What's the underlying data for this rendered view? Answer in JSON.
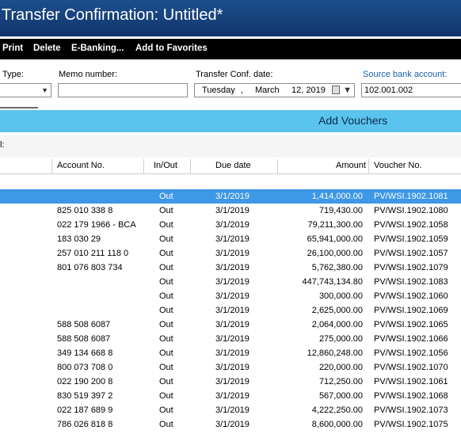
{
  "window": {
    "title": "Transfer Confirmation: Untitled*"
  },
  "toolbar": {
    "print": "Print",
    "delete": "Delete",
    "ebanking": "E-Banking...",
    "favorites": "Add to Favorites"
  },
  "form": {
    "type_label": "Type:",
    "type_value": "",
    "memo_label": "Memo number:",
    "memo_value": "",
    "date_label": "Transfer Conf. date:",
    "date_weekday": "Tuesday",
    "date_sep": ",",
    "date_month": "March",
    "date_daymonth": "12, 2019",
    "source_label": "Source bank account:",
    "source_value": "102.001.002"
  },
  "add_vouchers": "Add Vouchers",
  "subbar_text": "l:",
  "table": {
    "headers": {
      "account": "Account No.",
      "inout": "In/Out",
      "due": "Due date",
      "amount": "Amount",
      "voucher": "Voucher No."
    },
    "rows": [
      {
        "account": "",
        "inout": "Out",
        "due": "3/1/2019",
        "amount": "1,414,000.00",
        "voucher": "PV/WSI.1902.1081"
      },
      {
        "account": "825 010 338 8",
        "inout": "Out",
        "due": "3/1/2019",
        "amount": "719,430.00",
        "voucher": "PV/WSI.1902.1080"
      },
      {
        "account": "022 179 1966 - BCA",
        "inout": "Out",
        "due": "3/1/2019",
        "amount": "79,211,300.00",
        "voucher": "PV/WSI.1902.1058"
      },
      {
        "account": "183 030 29",
        "inout": "Out",
        "due": "3/1/2019",
        "amount": "65,941,000.00",
        "voucher": "PV/WSI.1902.1059"
      },
      {
        "account": "257 010 211 118 0",
        "inout": "Out",
        "due": "3/1/2019",
        "amount": "26,100,000.00",
        "voucher": "PV/WSI.1902.1057"
      },
      {
        "account": "801 076 803 734",
        "inout": "Out",
        "due": "3/1/2019",
        "amount": "5,762,380.00",
        "voucher": "PV/WSI.1902.1079"
      },
      {
        "account": "",
        "inout": "Out",
        "due": "3/1/2019",
        "amount": "447,743,134.80",
        "voucher": "PV/WSI.1902.1083"
      },
      {
        "account": "",
        "inout": "Out",
        "due": "3/1/2019",
        "amount": "300,000.00",
        "voucher": "PV/WSI.1902.1060"
      },
      {
        "account": "",
        "inout": "Out",
        "due": "3/1/2019",
        "amount": "2,625,000.00",
        "voucher": "PV/WSI.1902.1069"
      },
      {
        "account": "588 508 6087",
        "inout": "Out",
        "due": "3/1/2019",
        "amount": "2,064,000.00",
        "voucher": "PV/WSI.1902.1065"
      },
      {
        "account": "588 508 6087",
        "inout": "Out",
        "due": "3/1/2019",
        "amount": "275,000.00",
        "voucher": "PV/WSI.1902.1066"
      },
      {
        "account": "349 134 668 8",
        "inout": "Out",
        "due": "3/1/2019",
        "amount": "12,860,248.00",
        "voucher": "PV/WSI.1902.1056"
      },
      {
        "account": "800 073 708 0",
        "inout": "Out",
        "due": "3/1/2019",
        "amount": "220,000.00",
        "voucher": "PV/WSI.1902.1070"
      },
      {
        "account": "022 190 200 8",
        "inout": "Out",
        "due": "3/1/2019",
        "amount": "712,250.00",
        "voucher": "PV/WSI.1902.1061"
      },
      {
        "account": "830 519 397 2",
        "inout": "Out",
        "due": "3/1/2019",
        "amount": "567,000.00",
        "voucher": "PV/WSI.1902.1068"
      },
      {
        "account": "022 187 689 9",
        "inout": "Out",
        "due": "3/1/2019",
        "amount": "4,222,250.00",
        "voucher": "PV/WSI.1902.1073"
      },
      {
        "account": "786 026 818 8",
        "inout": "Out",
        "due": "3/1/2019",
        "amount": "8,600,000.00",
        "voucher": "PV/WSI.1902.1075"
      }
    ]
  },
  "colors": {
    "title_bar": "#163f78",
    "accent_bar": "#5bc4ee",
    "selected_row": "#3d98e6"
  }
}
